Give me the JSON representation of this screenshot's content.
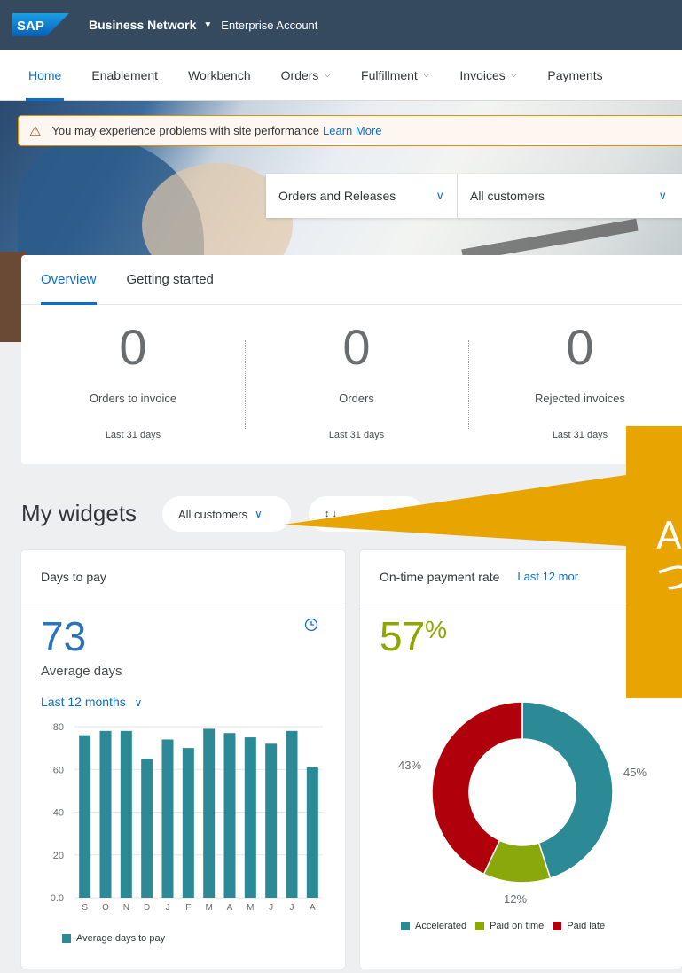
{
  "shell": {
    "logo": "SAP",
    "title": "Business Network",
    "subtitle": "Enterprise Account"
  },
  "nav": {
    "items": [
      {
        "label": "Home",
        "chevron": false
      },
      {
        "label": "Enablement",
        "chevron": false
      },
      {
        "label": "Workbench",
        "chevron": false
      },
      {
        "label": "Orders",
        "chevron": true
      },
      {
        "label": "Fulfillment",
        "chevron": true
      },
      {
        "label": "Invoices",
        "chevron": true
      },
      {
        "label": "Payments",
        "chevron": false
      }
    ]
  },
  "alert": {
    "text": "You may experience problems with site performance",
    "link": "Learn More"
  },
  "filters": {
    "document_type": "Orders and Releases",
    "customer": "All customers"
  },
  "overview": {
    "tabs": [
      "Overview",
      "Getting started"
    ],
    "kpis": [
      {
        "value": "0",
        "label": "Orders to invoice",
        "period": "Last 31 days"
      },
      {
        "value": "0",
        "label": "Orders",
        "period": "Last 31 days"
      },
      {
        "value": "0",
        "label": "Rejected invoices",
        "period": "Last 31 days"
      }
    ]
  },
  "widgets": {
    "title": "My widgets",
    "customer_filter": "All customers",
    "second_pill": "↕ ↓",
    "callout_text": "A\nづ"
  },
  "days_to_pay": {
    "title": "Days to pay",
    "value": "73",
    "value_label": "Average days",
    "period": "Last 12 months"
  },
  "ontime": {
    "title": "On-time payment rate",
    "period": "Last 12 mor",
    "value": "57",
    "unit": "%"
  },
  "colors": {
    "teal": "#2b8a96",
    "green": "#8aa80b",
    "red": "#b0000b",
    "blue": "#0a6ed1"
  },
  "chart_data": [
    {
      "type": "bar",
      "categories": [
        "S",
        "O",
        "N",
        "D",
        "J",
        "F",
        "M",
        "A",
        "M",
        "J",
        "J",
        "A"
      ],
      "series": [
        {
          "name": "Average days to pay",
          "values": [
            76,
            78,
            78,
            65,
            74,
            70,
            79,
            77,
            75,
            72,
            78,
            61
          ]
        }
      ],
      "ylim": [
        0,
        80
      ],
      "yticks": [
        "0.0",
        "20",
        "40",
        "60",
        "80"
      ],
      "grid": true,
      "legend": "bottom-left"
    },
    {
      "type": "pie",
      "donut": true,
      "slices": [
        {
          "name": "Accelerated",
          "value": 45,
          "label": "45%"
        },
        {
          "name": "Paid on time",
          "value": 12,
          "label": "12%"
        },
        {
          "name": "Paid late",
          "value": 43,
          "label": "43%"
        }
      ],
      "legend": "bottom"
    }
  ]
}
